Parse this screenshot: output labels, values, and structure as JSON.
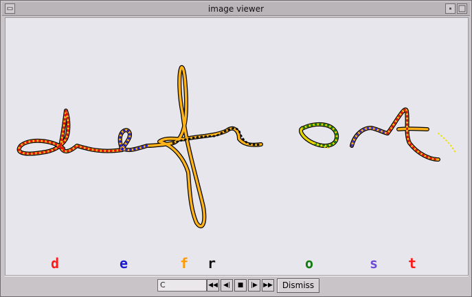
{
  "window": {
    "title": "image viewer"
  },
  "letters": [
    {
      "char": "d",
      "color": "#ff1a1a"
    },
    {
      "char": "e",
      "color": "#1a1ad0"
    },
    {
      "char": "f",
      "color": "#ff9a00"
    },
    {
      "char": "r",
      "color": "#111111"
    },
    {
      "char": "o",
      "color": "#0f7a0f"
    },
    {
      "char": "s",
      "color": "#6a4ad6"
    },
    {
      "char": "t",
      "color": "#ff1a1a"
    }
  ],
  "controls": {
    "frame_value": "C",
    "first_icon": "first-frame-icon",
    "prev_icon": "step-back-icon",
    "stop_icon": "stop-icon",
    "next_icon": "step-forward-icon",
    "last_icon": "last-frame-icon",
    "dismiss_label": "Dismiss"
  }
}
